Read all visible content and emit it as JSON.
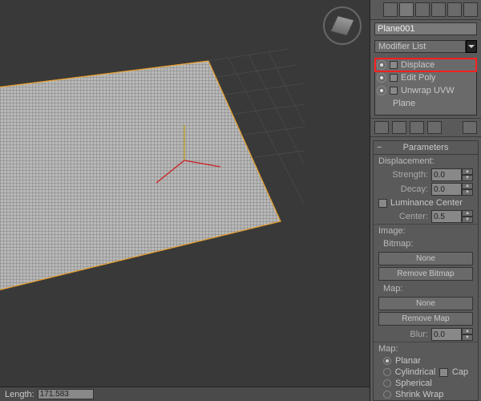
{
  "object_name": "Plane001",
  "modifier_dropdown": "Modifier List",
  "stack": [
    {
      "label": "Displace",
      "highlight": true,
      "icon": "box"
    },
    {
      "label": "Edit Poly",
      "highlight": false,
      "icon": "box"
    },
    {
      "label": "Unwrap UVW",
      "highlight": false,
      "icon": "box"
    },
    {
      "label": "Plane",
      "highlight": false,
      "icon": "none"
    }
  ],
  "rollout": {
    "title": "Parameters",
    "displacement_label": "Displacement:",
    "strength": {
      "label": "Strength:",
      "value": "0.0"
    },
    "decay": {
      "label": "Decay:",
      "value": "0.0"
    },
    "lum_center": "Luminance Center",
    "center": {
      "label": "Center:",
      "value": "0.5"
    },
    "image_label": "Image:",
    "bitmap_label": "Bitmap:",
    "none_btn": "None",
    "remove_bitmap": "Remove Bitmap",
    "map_label": "Map:",
    "remove_map": "Remove Map",
    "blur": {
      "label": "Blur:",
      "value": "0.0"
    },
    "map_section": "Map:",
    "planar": "Planar",
    "cylindrical": "Cylindrical",
    "cap": "Cap",
    "spherical": "Spherical",
    "shrinkwrap": "Shrink Wrap"
  },
  "status": {
    "label": "Length:",
    "value": "171.583"
  }
}
